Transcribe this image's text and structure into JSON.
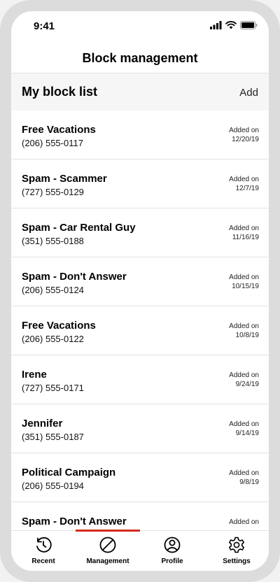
{
  "status_bar": {
    "time": "9:41",
    "icons": [
      "signal-icon",
      "wifi-icon",
      "battery-icon"
    ]
  },
  "header": {
    "title": "Block management"
  },
  "section": {
    "title": "My block list",
    "add_label": "Add"
  },
  "block_list": [
    {
      "name": "Free Vacations",
      "phone": "(206) 555-0117",
      "added_label": "Added on",
      "added_date": "12/20/19"
    },
    {
      "name": "Spam - Scammer",
      "phone": "(727) 555-0129",
      "added_label": "Added on",
      "added_date": "12/7/19"
    },
    {
      "name": "Spam - Car Rental Guy",
      "phone": "(351) 555-0188",
      "added_label": "Added on",
      "added_date": "11/16/19"
    },
    {
      "name": "Spam - Don't Answer",
      "phone": "(206) 555-0124",
      "added_label": "Added on",
      "added_date": "10/15/19"
    },
    {
      "name": "Free Vacations",
      "phone": "(206) 555-0122",
      "added_label": "Added on",
      "added_date": "10/8/19"
    },
    {
      "name": "Irene",
      "phone": "(727) 555-0171",
      "added_label": "Added on",
      "added_date": "9/24/19"
    },
    {
      "name": "Jennifer",
      "phone": "(351) 555-0187",
      "added_label": "Added on",
      "added_date": "9/14/19"
    },
    {
      "name": "Political Campaign",
      "phone": "(206) 555-0194",
      "added_label": "Added on",
      "added_date": "9/8/19"
    },
    {
      "name": "Spam - Don't Answer",
      "phone": "",
      "added_label": "Added on",
      "added_date": ""
    }
  ],
  "bottom_nav": {
    "active": "Management",
    "accent_color": "#d52b1e",
    "items": [
      {
        "label": "Recent",
        "icon": "recent-clock-icon"
      },
      {
        "label": "Management",
        "icon": "block-icon"
      },
      {
        "label": "Profile",
        "icon": "profile-icon"
      },
      {
        "label": "Settings",
        "icon": "gear-icon"
      }
    ]
  }
}
